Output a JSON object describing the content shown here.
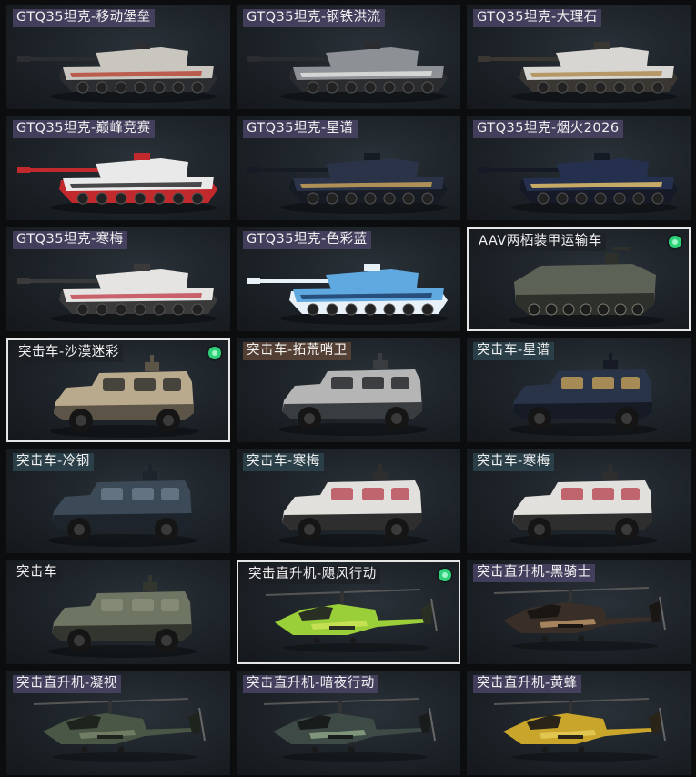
{
  "cards": [
    {
      "label": "GTQ35坦克-移动堡垒",
      "type": "tank",
      "tag": "purple",
      "colors": [
        "#c9c6c0",
        "#2b2d30",
        "#b84a3a"
      ]
    },
    {
      "label": "GTQ35坦克-钢铁洪流",
      "type": "tank",
      "tag": "purple",
      "colors": [
        "#8d9196",
        "#2a2c2f",
        "#e0e0e0"
      ]
    },
    {
      "label": "GTQ35坦克-大理石",
      "type": "tank",
      "tag": "purple",
      "colors": [
        "#d8d6d2",
        "#3a3733",
        "#b08d55"
      ]
    },
    {
      "label": "GTQ35坦克-巅峰竞赛",
      "type": "tank",
      "tag": "purple",
      "colors": [
        "#e9e9e9",
        "#c2292c",
        "#2b2b2e"
      ]
    },
    {
      "label": "GTQ35坦克-星谱",
      "type": "tank",
      "tag": "purple",
      "colors": [
        "#2a3347",
        "#171b23",
        "#c7a15a"
      ]
    },
    {
      "label": "GTQ35坦克-烟火2026",
      "type": "tank",
      "tag": "purple",
      "colors": [
        "#25304f",
        "#161a26",
        "#e4c06a"
      ]
    },
    {
      "label": "GTQ35坦克-寒梅",
      "type": "tank",
      "tag": "purple",
      "colors": [
        "#e6e4e2",
        "#3a3a3a",
        "#c24a55"
      ]
    },
    {
      "label": "GTQ35坦克-色彩蓝",
      "type": "tank",
      "tag": "purple",
      "colors": [
        "#5fa8e0",
        "#e9f1f8",
        "#1e3f6a"
      ]
    },
    {
      "label": "AAV两栖装甲运输车",
      "type": "aav",
      "tag": "dark",
      "selected": true,
      "owned": true,
      "colors": [
        "#5d6256",
        "#2e302b",
        "#7a7f70"
      ]
    },
    {
      "label": "突击车-沙漠迷彩",
      "type": "car",
      "tag": "dark",
      "selected": true,
      "owned": true,
      "colors": [
        "#b9aa8e",
        "#5d5448",
        "#2a2a2a"
      ]
    },
    {
      "label": "突击车-拓荒哨卫",
      "type": "car",
      "tag": "brown",
      "colors": [
        "#b5b5b5",
        "#3a3d40",
        "#1f2124"
      ]
    },
    {
      "label": "突击车-星谱",
      "type": "car",
      "tag": "teal",
      "colors": [
        "#2a3448",
        "#161b25",
        "#c7a15a"
      ]
    },
    {
      "label": "突击车-冷钢",
      "type": "car",
      "tag": "teal",
      "colors": [
        "#3c4a58",
        "#1d242c",
        "#6d7d8c"
      ]
    },
    {
      "label": "突击车-寒梅",
      "type": "car",
      "tag": "teal",
      "colors": [
        "#e2e0dd",
        "#2e2e2e",
        "#b84652"
      ]
    },
    {
      "label": "突击车-寒梅",
      "type": "car",
      "tag": "teal",
      "colors": [
        "#e2e0dd",
        "#2e2e2e",
        "#b84652"
      ]
    },
    {
      "label": "突击车",
      "type": "car",
      "tag": "dark",
      "colors": [
        "#6f7563",
        "#33362e",
        "#8b907c"
      ]
    },
    {
      "label": "突击直升机-飓风行动",
      "type": "heli",
      "tag": "dark",
      "selected": true,
      "owned": true,
      "colors": [
        "#9bcf3a",
        "#2a2f24",
        "#d0e45a"
      ]
    },
    {
      "label": "突击直升机-黑骑士",
      "type": "heli",
      "tag": "purple",
      "colors": [
        "#3a2e28",
        "#1a1614",
        "#c09a6a"
      ]
    },
    {
      "label": "突击直升机-凝视",
      "type": "heli",
      "tag": "purple",
      "colors": [
        "#4a5746",
        "#1f231d",
        "#7b866d"
      ]
    },
    {
      "label": "突击直升机-暗夜行动",
      "type": "heli",
      "tag": "purple",
      "colors": [
        "#3e4a45",
        "#181c1b",
        "#8ea889"
      ]
    },
    {
      "label": "突击直升机-黄蜂",
      "type": "heli",
      "tag": "purple",
      "colors": [
        "#c9a52c",
        "#2a2418",
        "#e6cd5a"
      ]
    }
  ]
}
